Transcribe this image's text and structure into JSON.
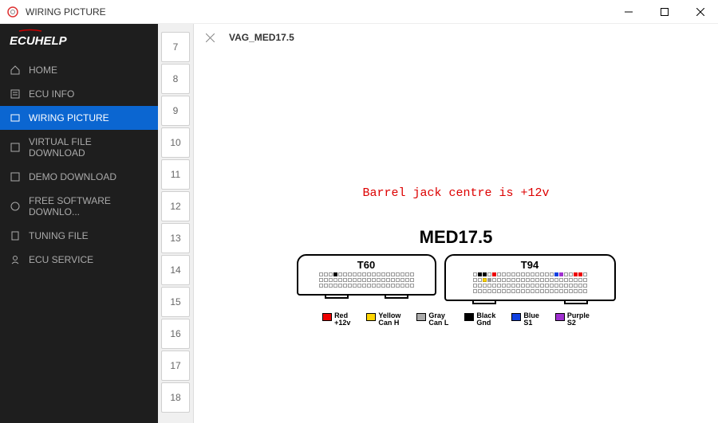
{
  "window": {
    "title": "WIRING PICTURE"
  },
  "logo": {
    "text": "ECUHELP"
  },
  "sidebar": {
    "items": [
      {
        "label": "HOME"
      },
      {
        "label": "ECU INFO"
      },
      {
        "label": "WIRING PICTURE"
      },
      {
        "label": "VIRTUAL FILE DOWNLOAD"
      },
      {
        "label": "DEMO DOWNLOAD"
      },
      {
        "label": "FREE SOFTWARE DOWNLO..."
      },
      {
        "label": "TUNING FILE"
      },
      {
        "label": "ECU SERVICE"
      }
    ]
  },
  "numbers": [
    "7",
    "8",
    "9",
    "10",
    "11",
    "12",
    "13",
    "14",
    "15",
    "16",
    "17",
    "18"
  ],
  "document": {
    "title": "VAG_MED17.5",
    "barrel_note": "Barrel jack centre is +12v",
    "chip_title": "MED17.5",
    "connectors": [
      {
        "name": "T60"
      },
      {
        "name": "T94"
      }
    ]
  },
  "legend": [
    {
      "color": "red",
      "l1": "Red",
      "l2": "+12v"
    },
    {
      "color": "yellow",
      "l1": "Yellow",
      "l2": "Can H"
    },
    {
      "color": "gray",
      "l1": "Gray",
      "l2": "Can L"
    },
    {
      "color": "black",
      "l1": "Black",
      "l2": "Gnd"
    },
    {
      "color": "blue",
      "l1": "Blue",
      "l2": "S1"
    },
    {
      "color": "purple",
      "l1": "Purple",
      "l2": "S2"
    }
  ]
}
